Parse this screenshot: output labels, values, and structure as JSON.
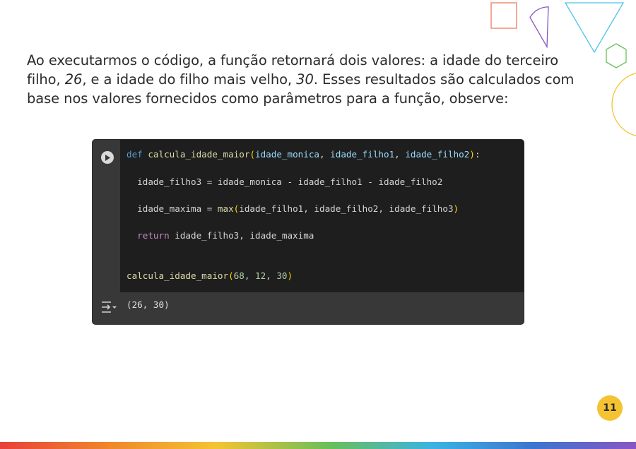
{
  "paragraph": {
    "part1": "Ao executarmos o código, a função retornará dois valores: a idade do terceiro filho, ",
    "value1": "26",
    "part2": ", e a idade do filho mais velho, ",
    "value2": "30",
    "part3": ". Esses resultados são calculados com base nos valores fornecidos como parâmetros para a função, observe:"
  },
  "code": {
    "line1": {
      "keyword": "def",
      "func": "calcula_idade_maior",
      "open": "(",
      "p1": "idade_monica",
      "sep1": ", ",
      "p2": "idade_filho1",
      "sep2": ", ",
      "p3": "idade_filho2",
      "close": ")",
      "colon": ":"
    },
    "line2": "  idade_filho3 = idade_monica - idade_filho1 - idade_filho2",
    "line3": {
      "prefix": "  idade_maxima = ",
      "func": "max",
      "open": "(",
      "args": "idade_filho1, idade_filho2, idade_filho3",
      "close": ")"
    },
    "line4": {
      "indent": "  ",
      "keyword": "return",
      "rest": " idade_filho3, idade_maxima"
    },
    "line5": {
      "func": "calcula_idade_maior",
      "open": "(",
      "n1": "68",
      "sep1": ", ",
      "n2": "12",
      "sep2": ", ",
      "n3": "30",
      "close": ")"
    }
  },
  "output": "(26, 30)",
  "page_number": "11",
  "colors": {
    "square": "#f07a5a",
    "semicircle": "#8a55c4",
    "triangle": "#4fc3e8",
    "hexagon": "#69bf5a",
    "circle": "#f5c332",
    "page_badge": "#f5c332"
  },
  "icons": [
    "run-cell-icon",
    "output-toggle-icon"
  ]
}
